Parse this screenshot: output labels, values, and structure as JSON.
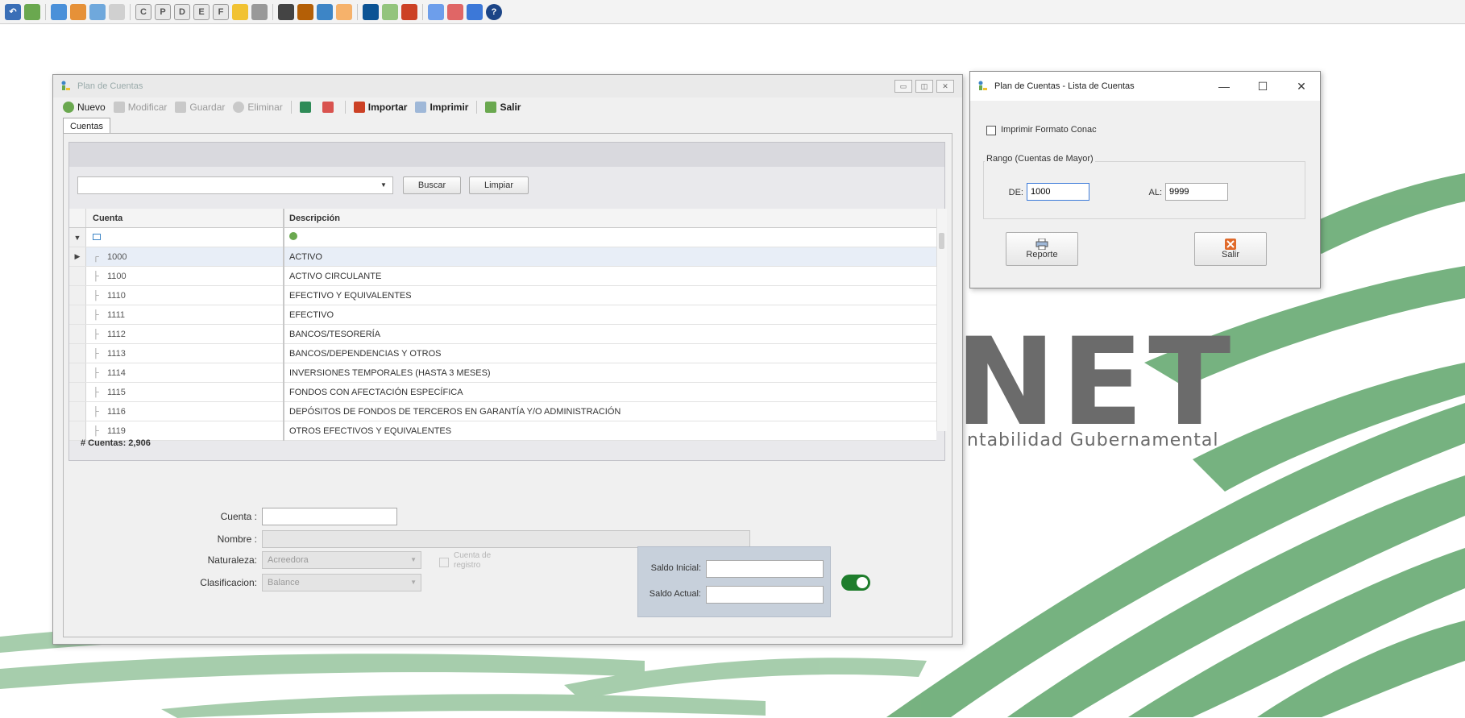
{
  "main_window": {
    "title": "Plan de Cuentas",
    "controls": {
      "minimize": "▭",
      "restore": "◫",
      "close": "✕"
    },
    "toolbar": {
      "nuevo": "Nuevo",
      "modificar": "Modificar",
      "guardar": "Guardar",
      "eliminar": "Eliminar",
      "importar": "Importar",
      "imprimir": "Imprimir",
      "salir": "Salir"
    },
    "tab": "Cuentas",
    "search": {
      "placeholder": "",
      "buscar": "Buscar",
      "limpiar": "Limpiar",
      "dropdown_glyph": "▼"
    },
    "grid": {
      "headers": {
        "cuenta": "Cuenta",
        "descripcion": "Descripción"
      },
      "rows": [
        {
          "cuenta": "1000",
          "descripcion": "ACTIVO"
        },
        {
          "cuenta": "1100",
          "descripcion": "ACTIVO CIRCULANTE"
        },
        {
          "cuenta": "1110",
          "descripcion": "EFECTIVO Y EQUIVALENTES"
        },
        {
          "cuenta": "1111",
          "descripcion": "EFECTIVO"
        },
        {
          "cuenta": "1112",
          "descripcion": "BANCOS/TESORERÍA"
        },
        {
          "cuenta": "1113",
          "descripcion": "BANCOS/DEPENDENCIAS Y OTROS"
        },
        {
          "cuenta": "1114",
          "descripcion": "INVERSIONES TEMPORALES (HASTA 3 MESES)"
        },
        {
          "cuenta": "1115",
          "descripcion": "FONDOS CON AFECTACIÓN ESPECÍFICA"
        },
        {
          "cuenta": "1116",
          "descripcion": "DEPÓSITOS DE FONDOS DE TERCEROS EN GARANTÍA Y/O ADMINISTRACIÓN"
        },
        {
          "cuenta": "1119",
          "descripcion": "OTROS EFECTIVOS Y EQUIVALENTES"
        }
      ],
      "count_label": "# Cuentas: 2,906"
    },
    "form": {
      "cuenta_label": "Cuenta :",
      "nombre_label": "Nombre :",
      "naturaleza_label": "Naturaleza:",
      "naturaleza_value": "Acreedora",
      "clasificacion_label": "Clasificacion:",
      "clasificacion_value": "Balance",
      "cuenta_registro_label": "Cuenta de registro",
      "saldo_inicial_label": "Saldo Inicial:",
      "saldo_actual_label": "Saldo Actual:"
    }
  },
  "list_window": {
    "title": "Plan de Cuentas - Lista de Cuentas",
    "controls": {
      "minimize": "—",
      "maximize": "☐",
      "close": "✕"
    },
    "imprimir_formato_conac": "Imprimir Formato Conac",
    "rango_label": "Rango (Cuentas de Mayor)",
    "de_label": "DE:",
    "de_value": "1000",
    "al_label": "AL:",
    "al_value": "9999",
    "reporte_button": "Reporte",
    "salir_button": "Salir"
  },
  "background": {
    "logo_text": "NET",
    "logo_subtitle": "ntabilidad Gubernamental"
  },
  "colors": {
    "toggle_on": "#1e7d2c",
    "swoosh_green": "#5fa56a"
  },
  "toggle_state": "on"
}
